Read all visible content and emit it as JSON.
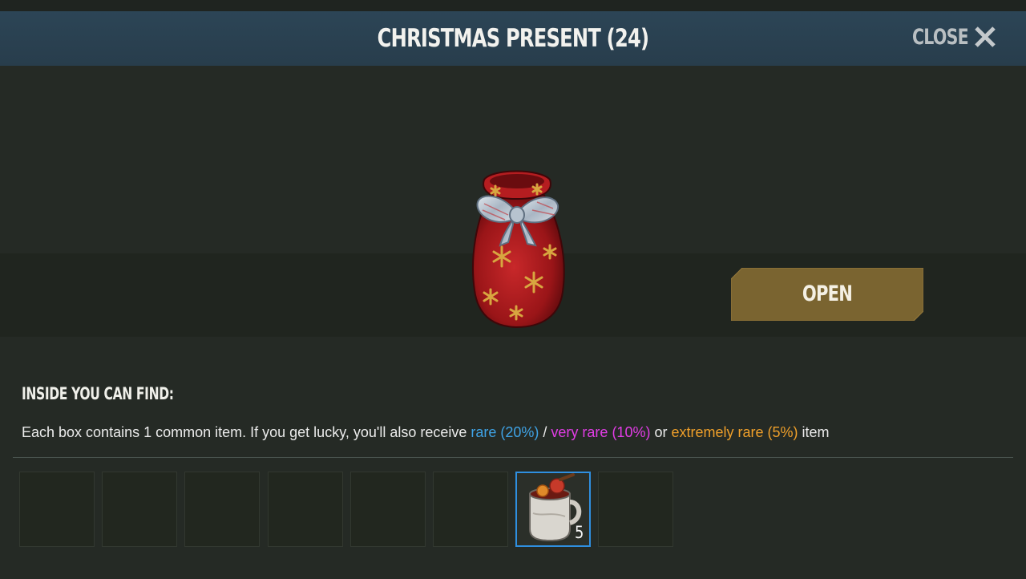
{
  "header": {
    "title": "CHRISTMAS PRESENT (24)",
    "close_label": "CLOSE",
    "close_icon": "close-icon"
  },
  "item": {
    "icon": "christmas-present-sack-icon"
  },
  "open_button": {
    "label": "OPEN"
  },
  "contents": {
    "heading": "INSIDE YOU CAN FIND:",
    "description": {
      "intro": "Each box contains 1 common item. If you get lucky, you'll also receive ",
      "rare": "rare (20%)",
      "sep1": " / ",
      "very_rare": "very rare (10%)",
      "sep2": " or ",
      "extremely_rare": "extremely rare (5%)",
      "outro": " item"
    },
    "colors": {
      "rare": "#3fa3e6",
      "very_rare": "#e23de6",
      "extremely_rare": "#f0a02a"
    }
  },
  "slots": [
    {
      "filled": false
    },
    {
      "filled": false
    },
    {
      "filled": false
    },
    {
      "filled": false
    },
    {
      "filled": false
    },
    {
      "filled": false
    },
    {
      "filled": true,
      "icon": "mulled-wine-mug-icon",
      "count": "5",
      "selected": true
    },
    {
      "filled": false
    }
  ]
}
